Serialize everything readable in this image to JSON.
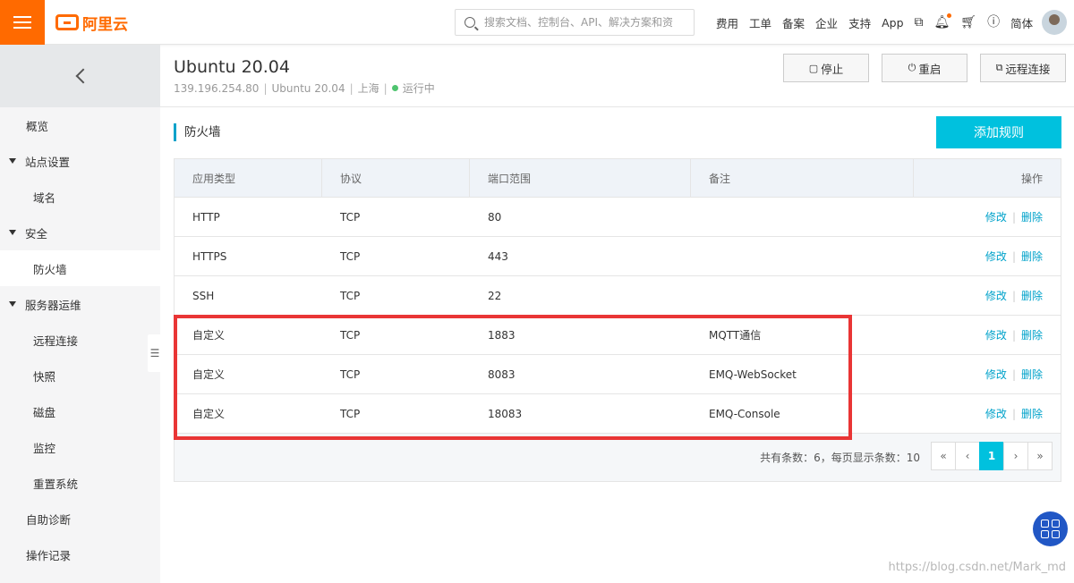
{
  "topbar": {
    "logo_text": "阿里云",
    "search_placeholder": "搜索文档、控制台、API、解决方案和资",
    "nav": [
      "费用",
      "工单",
      "备案",
      "企业",
      "支持",
      "App"
    ],
    "lang": "简体",
    "icons": [
      "terminal-icon",
      "bell-icon",
      "cart-icon",
      "help-icon"
    ],
    "accent": "#ff6a00"
  },
  "sidebar": {
    "items": [
      {
        "label": "概览",
        "level": "l1"
      },
      {
        "label": "站点设置",
        "level": "grp"
      },
      {
        "label": "域名",
        "level": "l2"
      },
      {
        "label": "安全",
        "level": "grp"
      },
      {
        "label": "防火墙",
        "level": "l2",
        "active": true
      },
      {
        "label": "服务器运维",
        "level": "grp"
      },
      {
        "label": "远程连接",
        "level": "l2"
      },
      {
        "label": "快照",
        "level": "l2"
      },
      {
        "label": "磁盘",
        "level": "l2"
      },
      {
        "label": "监控",
        "level": "l2"
      },
      {
        "label": "重置系统",
        "level": "l2"
      },
      {
        "label": "自助诊断",
        "level": "l1"
      },
      {
        "label": "操作记录",
        "level": "l1"
      }
    ]
  },
  "header": {
    "title": "Ubuntu 20.04",
    "ip": "139.196.254.80",
    "os": "Ubuntu 20.04",
    "region": "上海",
    "status": "运行中",
    "status_color": "#4fc46f",
    "buttons": {
      "stop": "停止",
      "restart": "重启",
      "remote": "远程连接"
    }
  },
  "firewall": {
    "title": "防火墙",
    "add_label": "添加规则",
    "columns": [
      "应用类型",
      "协议",
      "端口范围",
      "备注",
      "操作"
    ],
    "rows": [
      {
        "type": "HTTP",
        "protocol": "TCP",
        "port": "80",
        "note": ""
      },
      {
        "type": "HTTPS",
        "protocol": "TCP",
        "port": "443",
        "note": ""
      },
      {
        "type": "SSH",
        "protocol": "TCP",
        "port": "22",
        "note": ""
      },
      {
        "type": "自定义",
        "protocol": "TCP",
        "port": "1883",
        "note": "MQTT通信"
      },
      {
        "type": "自定义",
        "protocol": "TCP",
        "port": "8083",
        "note": "EMQ-WebSocket"
      },
      {
        "type": "自定义",
        "protocol": "TCP",
        "port": "18083",
        "note": "EMQ-Console"
      }
    ],
    "edit_label": "修改",
    "delete_label": "删除",
    "total_text": "共有条数：6，每页显示条数：10",
    "pager": [
      "«",
      "‹",
      "1",
      "›",
      "»"
    ],
    "current_page": "1"
  },
  "watermark": "https://blog.csdn.net/Mark_md",
  "colors": {
    "primary": "#00c1de",
    "link": "#00a2ca",
    "highlight": "#e93535"
  }
}
